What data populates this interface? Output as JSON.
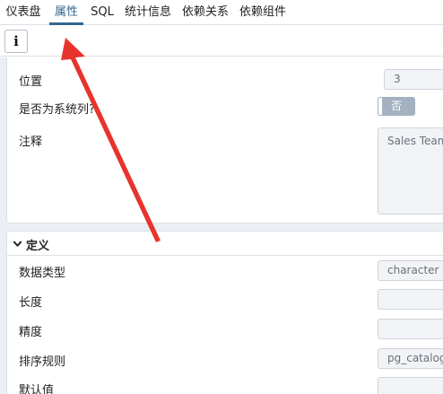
{
  "tabs": [
    {
      "label": "仪表盘"
    },
    {
      "label": "属性"
    },
    {
      "label": "SQL"
    },
    {
      "label": "统计信息"
    },
    {
      "label": "依赖关系"
    },
    {
      "label": "依赖组件"
    }
  ],
  "active_tab": "属性",
  "toolbar": {
    "info_glyph": "i"
  },
  "general": {
    "position_label": "位置",
    "position_value": "3",
    "system_column_label": "是否为系统列?",
    "system_column_value": "否",
    "comment_label": "注释",
    "comment_value": "Sales Team"
  },
  "definition": {
    "title": "定义",
    "data_type_label": "数据类型",
    "data_type_value": "character va",
    "length_label": "长度",
    "length_value": "",
    "precision_label": "精度",
    "precision_value": "",
    "collation_label": "排序规则",
    "collation_value": "pg_catalog.\"",
    "default_label": "默认值",
    "default_value": ""
  },
  "annotation": {
    "arrow_color": "#e8332c"
  },
  "colors": {
    "accent": "#326690",
    "toggle_off": "#a3b1c0"
  }
}
